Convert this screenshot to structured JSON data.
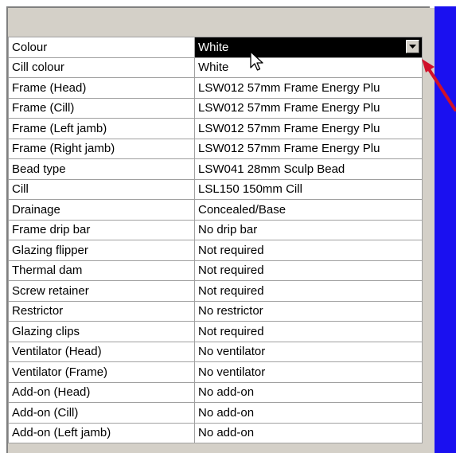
{
  "properties": [
    {
      "label": "Colour",
      "value": "White",
      "selected": true
    },
    {
      "label": "Cill colour",
      "value": "White"
    },
    {
      "label": "Frame (Head)",
      "value": "LSW012 57mm Frame Energy Plu"
    },
    {
      "label": "Frame (Cill)",
      "value": "LSW012 57mm Frame Energy Plu"
    },
    {
      "label": "Frame (Left jamb)",
      "value": "LSW012 57mm Frame Energy Plu"
    },
    {
      "label": "Frame (Right jamb)",
      "value": "LSW012 57mm Frame Energy Plu"
    },
    {
      "label": "Bead type",
      "value": "LSW041 28mm Sculp Bead"
    },
    {
      "label": "Cill",
      "value": "LSL150 150mm Cill"
    },
    {
      "label": "Drainage",
      "value": "Concealed/Base"
    },
    {
      "label": "Frame drip bar",
      "value": "No drip bar"
    },
    {
      "label": "Glazing flipper",
      "value": "Not required"
    },
    {
      "label": "Thermal dam",
      "value": "Not required"
    },
    {
      "label": "Screw retainer",
      "value": "Not required"
    },
    {
      "label": "Restrictor",
      "value": "No restrictor"
    },
    {
      "label": "Glazing clips",
      "value": "Not required"
    },
    {
      "label": "Ventilator (Head)",
      "value": "No ventilator"
    },
    {
      "label": "Ventilator (Frame)",
      "value": "No ventilator"
    },
    {
      "label": "Add-on (Head)",
      "value": "No add-on"
    },
    {
      "label": "Add-on (Cill)",
      "value": "No add-on"
    },
    {
      "label": "Add-on (Left jamb)",
      "value": "No add-on"
    }
  ],
  "icons": {
    "dropdown": "chevron-down-icon",
    "cursor": "mouse-pointer-icon",
    "annotation": "red-arrow-icon"
  },
  "colors": {
    "panel": "#d4d0c8",
    "selection": "#000000",
    "side": "#1a10f0",
    "arrow": "#d0102a"
  }
}
